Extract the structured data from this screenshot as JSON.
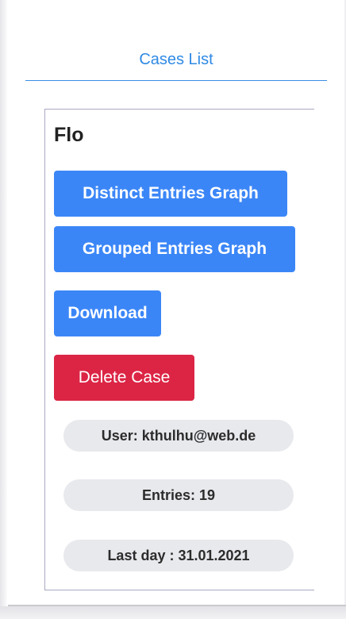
{
  "nav": {
    "tab_label": "Cases List"
  },
  "case": {
    "title": "Flo",
    "buttons": {
      "distinct_graph": "Distinct Entries Graph",
      "grouped_graph": "Grouped Entries Graph",
      "download": "Download",
      "delete": "Delete Case"
    },
    "info": {
      "user": "User: kthulhu@web.de",
      "entries": "Entries: 19",
      "last_day": "Last day : 31.01.2021"
    }
  },
  "colors": {
    "primary_button": "#3b86f7",
    "danger_button": "#dc2545",
    "tab_accent": "#2f8ae4",
    "pill_background": "#e8e9ed"
  }
}
